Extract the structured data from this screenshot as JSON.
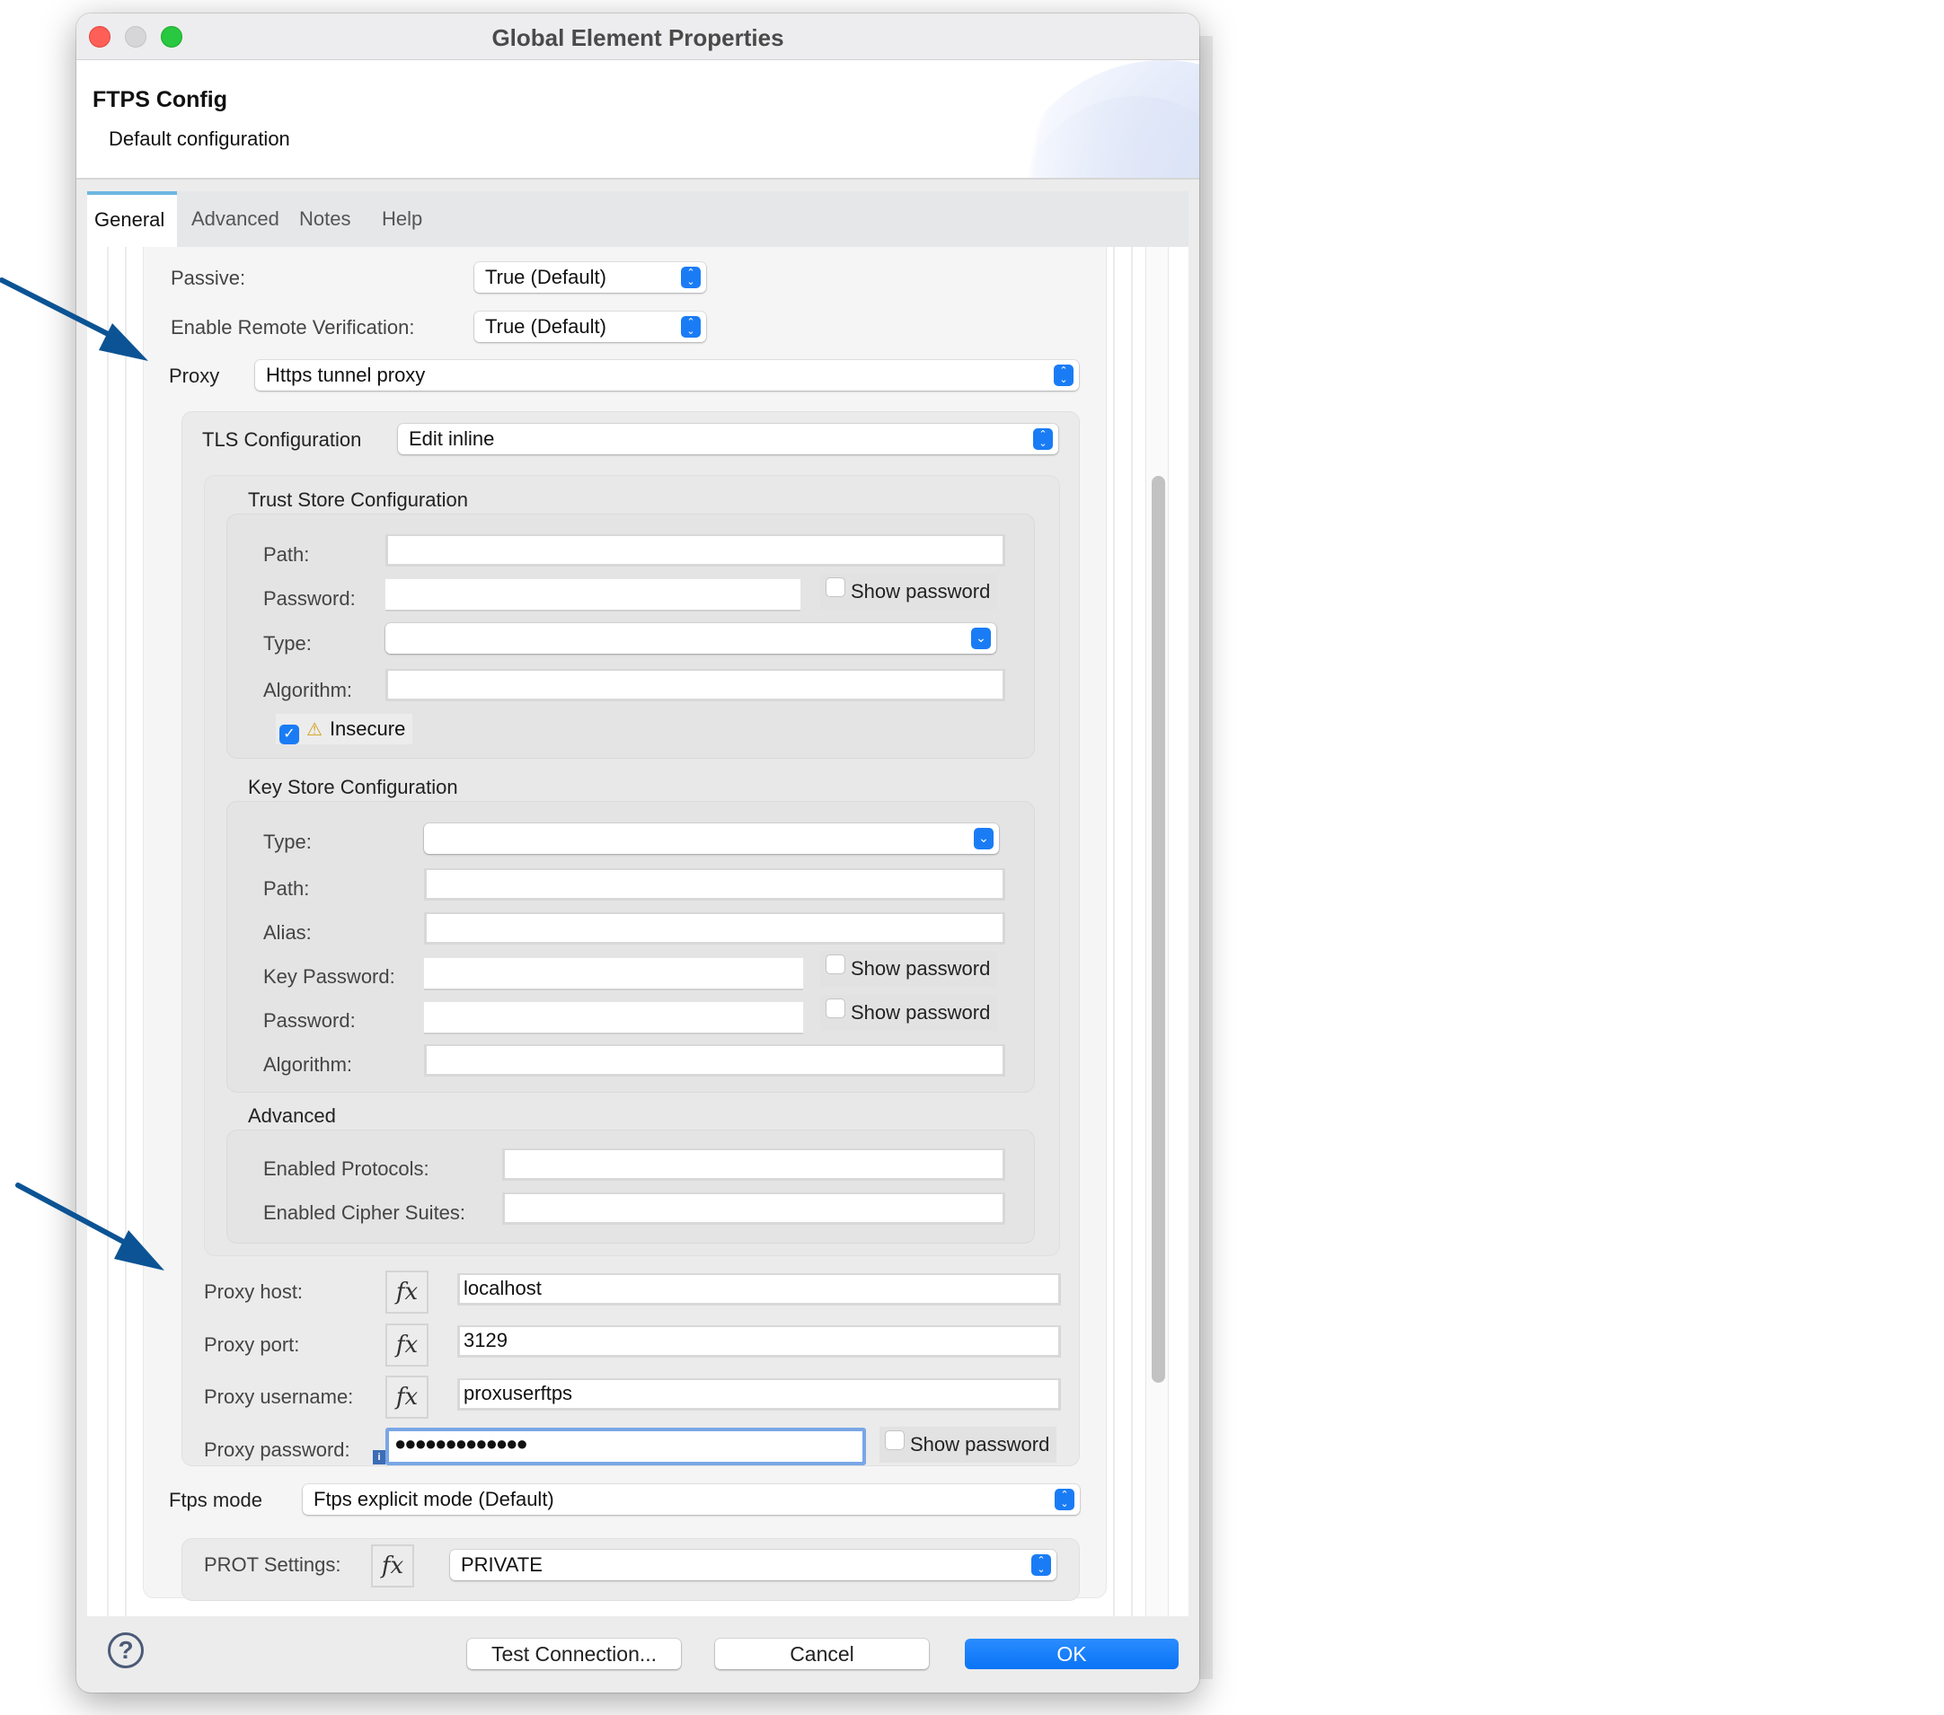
{
  "window": {
    "title": "Global Element Properties"
  },
  "header": {
    "title": "FTPS Config",
    "subtitle": "Default configuration"
  },
  "tabs": [
    {
      "label": "General",
      "active": true
    },
    {
      "label": "Advanced",
      "active": false
    },
    {
      "label": "Notes",
      "active": false
    },
    {
      "label": "Help",
      "active": false
    }
  ],
  "general": {
    "passive": {
      "label": "Passive:",
      "value": "True (Default)"
    },
    "remote_verification": {
      "label": "Enable Remote Verification:",
      "value": "True (Default)"
    },
    "proxy": {
      "label": "Proxy",
      "value": "Https tunnel proxy"
    },
    "tls": {
      "label": "TLS Configuration",
      "value": "Edit inline",
      "trust_store": {
        "title": "Trust Store Configuration",
        "path_label": "Path:",
        "path_value": "",
        "password_label": "Password:",
        "password_value": "",
        "show_password_label": "Show password",
        "show_password_checked": false,
        "type_label": "Type:",
        "type_value": "",
        "algorithm_label": "Algorithm:",
        "algorithm_value": "",
        "insecure_label": "Insecure",
        "insecure_checked": true
      },
      "key_store": {
        "title": "Key Store Configuration",
        "type_label": "Type:",
        "type_value": "",
        "path_label": "Path:",
        "path_value": "",
        "alias_label": "Alias:",
        "alias_value": "",
        "key_password_label": "Key Password:",
        "key_password_value": "",
        "key_show_password_label": "Show password",
        "password_label": "Password:",
        "password_value": "",
        "show_password_label": "Show password",
        "algorithm_label": "Algorithm:",
        "algorithm_value": ""
      },
      "advanced": {
        "title": "Advanced",
        "protocols_label": "Enabled Protocols:",
        "protocols_value": "",
        "cipher_label": "Enabled Cipher Suites:",
        "cipher_value": ""
      }
    },
    "proxy_host": {
      "label": "Proxy host:",
      "value": "localhost"
    },
    "proxy_port": {
      "label": "Proxy port:",
      "value": "3129"
    },
    "proxy_username": {
      "label": "Proxy username:",
      "value": "proxuserftps"
    },
    "proxy_password": {
      "label": "Proxy password:",
      "value": "●●●●●●●●●●●●●",
      "show_password_label": "Show password",
      "show_password_checked": false
    },
    "ftps_mode": {
      "label": "Ftps mode",
      "value": "Ftps explicit mode (Default)"
    },
    "prot_settings": {
      "label": "PROT Settings:",
      "value": "PRIVATE"
    },
    "fx_label": "fx"
  },
  "footer": {
    "help_glyph": "?",
    "test_connection": "Test Connection...",
    "cancel": "Cancel",
    "ok": "OK"
  },
  "icons": {
    "select_stepper": "⌃⌄",
    "dropdown_chevron": "⌄",
    "checkmark": "✓",
    "warning": "⚠",
    "info": "i"
  },
  "colors": {
    "accent": "#0a74f5",
    "arrow": "#0b5394",
    "focus_ring": "#7aa6e6",
    "tab_indicator": "#6cb6e0"
  }
}
